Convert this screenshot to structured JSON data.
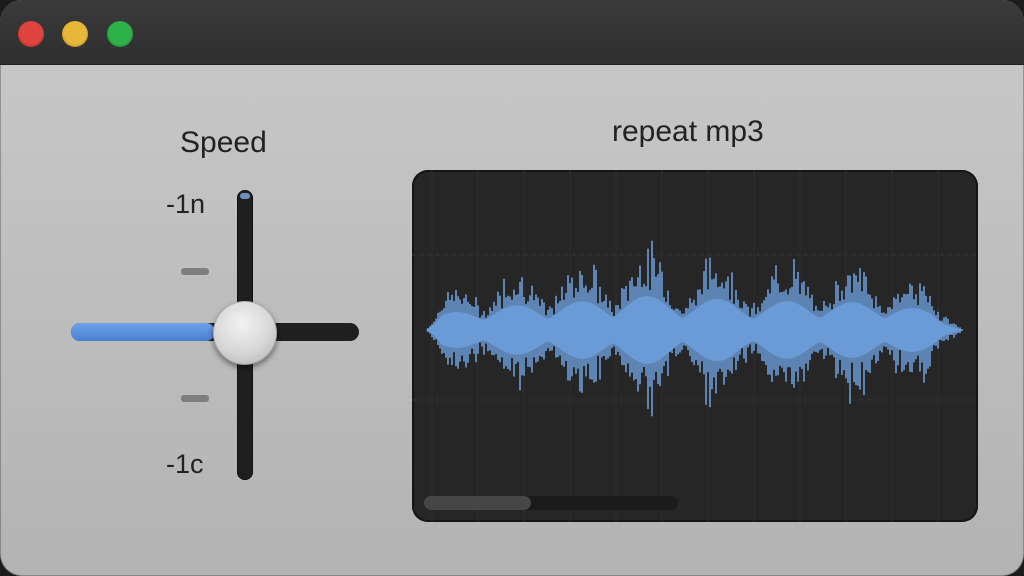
{
  "window": {
    "controls": {
      "close": "close",
      "minimize": "minimize",
      "zoom": "zoom"
    }
  },
  "speed": {
    "title": "Speed",
    "top_label": "-1n",
    "bottom_label": "-1c",
    "horizontal_level": 0.5,
    "vertical_level": 0.5
  },
  "waveform": {
    "title": "repeat mp3",
    "color": "#6b9bd6",
    "background": "#262626",
    "scroll_position": 0.0,
    "scroll_visible_fraction": 0.42
  },
  "colors": {
    "accent": "#4a7fd0",
    "close": "#e0443e",
    "minimize": "#e8b73a",
    "zoom": "#2fb14a"
  }
}
